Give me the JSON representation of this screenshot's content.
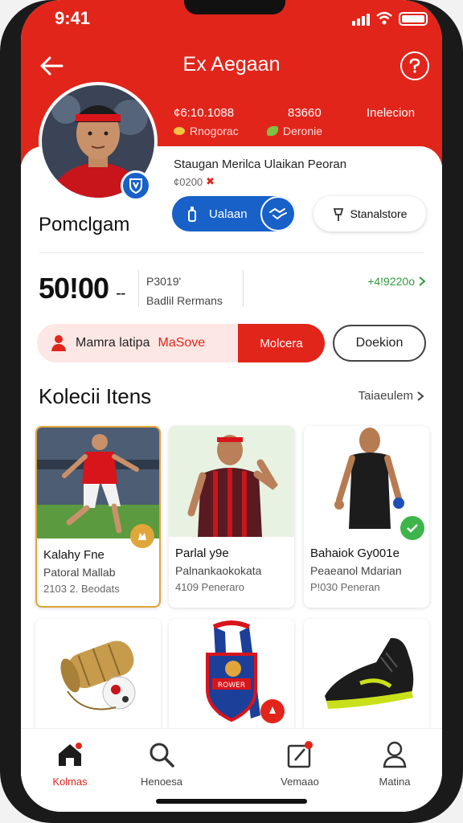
{
  "status": {
    "time": "9:41"
  },
  "header": {
    "title": "Ex Aegaan",
    "stats": [
      {
        "value": "¢6:10.1088",
        "label": "Rnogorac"
      },
      {
        "value": "83660",
        "label": "Deronie"
      },
      {
        "value": "Inelecion",
        "label": ""
      }
    ]
  },
  "profile": {
    "name": "Pomclgam",
    "line1": "Staugan Merilca Ulaikan Peoran",
    "line2": "¢0200",
    "primary_button": "Ualaan",
    "secondary_button": "Stanalstore"
  },
  "summary": {
    "big_value": "50!00",
    "big_suffix": "--",
    "info_top": "P3019'",
    "info_bottom": "Badlil Rermans",
    "link": "+4!9220o"
  },
  "action_bar": {
    "label_dark": "Mamra latipa",
    "label_red": "MaSove",
    "action": "Molcera",
    "outline_button": "Doekion"
  },
  "collection": {
    "title": "Kolecii Itens",
    "see_all": "Taiaeulem",
    "items": [
      {
        "title": "Kalahy Fne",
        "subtitle": "Patoral Mallab",
        "meta": "2103 2. Beodats"
      },
      {
        "title": "Parlal y9e",
        "subtitle": "Palnankaokokata",
        "meta": "4109 Peneraro"
      },
      {
        "title": "Bahaiok Gy001e",
        "subtitle": "Peaeanol Mdarian",
        "meta": "P!030 Peneran"
      }
    ],
    "row2": [
      {
        "icon": "ball-bag-icon"
      },
      {
        "icon": "club-scarf-icon",
        "badge_text": "ROWER"
      },
      {
        "icon": "football-boot-icon"
      }
    ]
  },
  "tabbar": {
    "tabs": [
      {
        "label": "Kolmas",
        "icon": "home-icon",
        "active": true
      },
      {
        "label": "Henoesa",
        "icon": "search-icon",
        "active": false
      },
      {
        "label": "Vemaao",
        "icon": "notes-icon",
        "active": false
      },
      {
        "label": "Matina",
        "icon": "user-icon",
        "active": false
      }
    ]
  },
  "colors": {
    "primary": "#e1251b",
    "accent_blue": "#1761c9",
    "positive": "#2c9b3a",
    "gold": "#e0a63a"
  }
}
